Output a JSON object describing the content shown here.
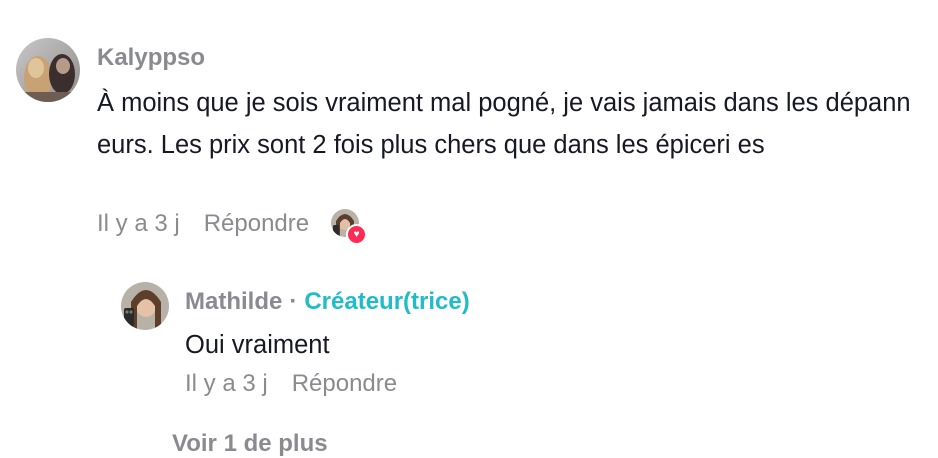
{
  "comment": {
    "username": "Kalyppso",
    "text": "À moins que je sois vraiment mal pogné, je vais jamais dans les dépanneurs. Les prix sont 2 fois plus chers que dans les épiceri es",
    "time": "Il y a 3 j",
    "reply_label": "Répondre",
    "liked_by_creator": true,
    "avatar_icon": "avatar-photo-icon",
    "heart_icon": "heart-icon"
  },
  "reply": {
    "username": "Mathilde",
    "separator": "·",
    "creator_badge": "Créateur(trice)",
    "text": "Oui vraiment",
    "time": "Il y a 3 j",
    "reply_label": "Répondre",
    "avatar_icon": "avatar-photo-icon"
  },
  "view_more": {
    "label": "Voir 1 de plus"
  },
  "colors": {
    "primary_text": "#161823",
    "secondary_text": "#8a8b91",
    "creator_accent": "#20bcc8",
    "heart": "#fe2c55"
  }
}
